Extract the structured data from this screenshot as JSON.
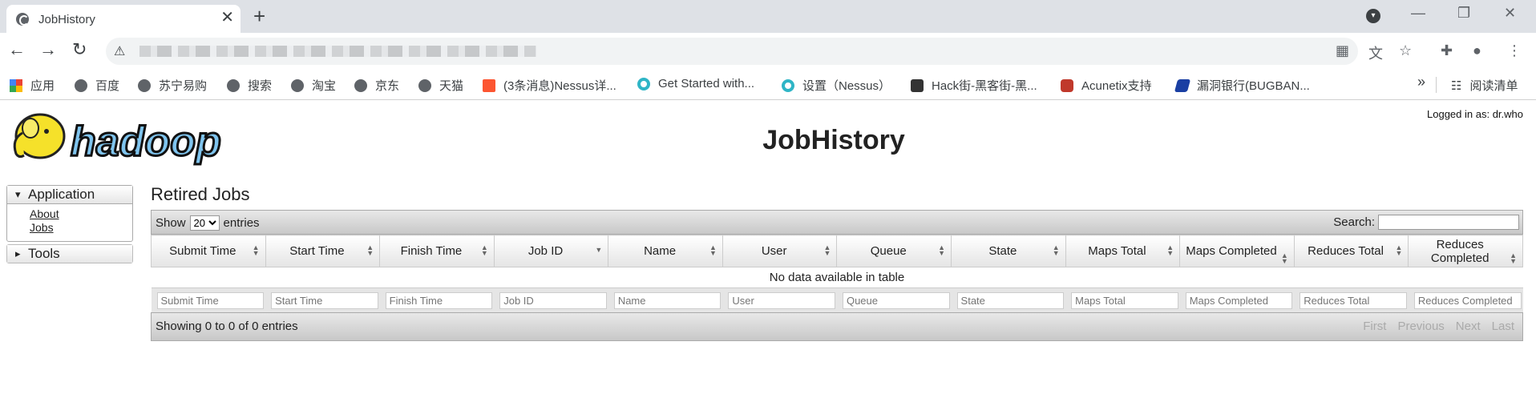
{
  "browser": {
    "tab_title": "JobHistory",
    "new_tab": "+",
    "close": "✕",
    "min": "—",
    "restore": "❐",
    "winclose": "✕"
  },
  "bookmarks": [
    "应用",
    "百度",
    "苏宁易购",
    "搜索",
    "淘宝",
    "京东",
    "天猫",
    "(3条消息)Nessus详...",
    "Get Started with...",
    "设置（Nessus）",
    "Hack街-黑客街-黑...",
    "Acunetix支持",
    "漏洞银行(BUGBAN..."
  ],
  "bookmarks_more": "»",
  "reading_list": "阅读清单",
  "page": {
    "title": "JobHistory",
    "logged_in": "Logged in as: dr.who",
    "logo": "hadoop"
  },
  "sidebar": {
    "application": "Application",
    "about": "About",
    "jobs": "Jobs",
    "tools": "Tools"
  },
  "main": {
    "heading": "Retired Jobs",
    "show": "Show",
    "page_size": "20",
    "entries": "entries",
    "search": "Search:",
    "empty": "No data available in table",
    "info": "Showing 0 to 0 of 0 entries",
    "columns": [
      "Submit Time",
      "Start Time",
      "Finish Time",
      "Job ID",
      "Name",
      "User",
      "Queue",
      "State",
      "Maps Total",
      "Maps Completed",
      "Reduces Total",
      "Reduces Completed"
    ],
    "pager": [
      "First",
      "Previous",
      "Next",
      "Last"
    ]
  }
}
